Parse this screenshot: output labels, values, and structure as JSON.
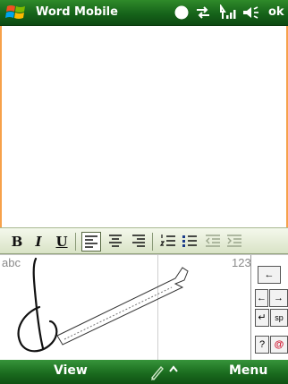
{
  "titlebar": {
    "app_title": "Word Mobile",
    "ok_label": "ok",
    "icons": [
      "windows-start-icon",
      "status-circle-icon",
      "connectivity-icon",
      "signal-icon",
      "volume-icon"
    ]
  },
  "format_toolbar": {
    "bold_label": "B",
    "italic_label": "I",
    "underline_label": "U",
    "active_alignment": "align-left"
  },
  "input_panel": {
    "letters_label": "abc",
    "numbers_label": "123",
    "keys": {
      "backspace": "←",
      "enter": "↵",
      "space": "sp",
      "help": "?",
      "at": "@"
    }
  },
  "softkeys": {
    "left_label": "View",
    "right_label": "Menu"
  },
  "colors": {
    "titlebar_green": "#16631a",
    "document_border": "#f7a14a",
    "toolbar_bg": "#d9e3c6",
    "softbar_green": "#1b6c1f"
  }
}
